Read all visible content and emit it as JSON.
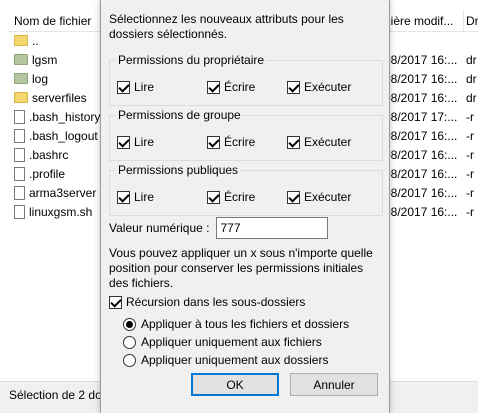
{
  "file_list": {
    "headers": {
      "name": "Nom de fichier",
      "date": "nière modif...",
      "perm": "Dr"
    },
    "rows": [
      {
        "name": "..",
        "icon": "folder-icon",
        "date": "",
        "perm": ""
      },
      {
        "name": "lgsm",
        "icon": "folder-green-icon",
        "date": "08/2017 16:...",
        "perm": "dr"
      },
      {
        "name": "log",
        "icon": "folder-green-icon",
        "date": "08/2017 16:...",
        "perm": "dr"
      },
      {
        "name": "serverfiles",
        "icon": "folder-icon",
        "date": "08/2017 16:...",
        "perm": "dr"
      },
      {
        "name": ".bash_history",
        "icon": "file-icon",
        "date": "08/2017 17:...",
        "perm": "-r"
      },
      {
        "name": ".bash_logout",
        "icon": "file-icon",
        "date": "08/2017 16:...",
        "perm": "-r"
      },
      {
        "name": ".bashrc",
        "icon": "file-icon",
        "date": "08/2017 16:...",
        "perm": "-r"
      },
      {
        "name": ".profile",
        "icon": "file-icon",
        "date": "08/2017 16:...",
        "perm": "-r"
      },
      {
        "name": "arma3server",
        "icon": "file-icon",
        "date": "08/2017 16:...",
        "perm": "-r"
      },
      {
        "name": "linuxgsm.sh",
        "icon": "file-icon",
        "date": "08/2017 16:...",
        "perm": "-r"
      }
    ],
    "status": "Sélection de 2 dos"
  },
  "dialog": {
    "intro": "Sélectionnez les nouveaux attributs pour les dossiers sélectionnés.",
    "groups": [
      {
        "title": "Permissions du propriétaire",
        "read": "Lire",
        "write": "Écrire",
        "execute": "Exécuter",
        "read_checked": true,
        "write_checked": true,
        "execute_checked": true
      },
      {
        "title": "Permissions de groupe",
        "read": "Lire",
        "write": "Écrire",
        "execute": "Exécuter",
        "read_checked": true,
        "write_checked": true,
        "execute_checked": true
      },
      {
        "title": "Permissions publiques",
        "read": "Lire",
        "write": "Écrire",
        "execute": "Exécuter",
        "read_checked": true,
        "write_checked": true,
        "execute_checked": true
      }
    ],
    "numeric_label": "Valeur numérique :",
    "numeric_value": "777",
    "hint": "Vous pouvez appliquer un x sous n'importe quelle position pour conserver les permissions initiales des fichiers.",
    "recurse_label": "Récursion dans les sous-dossiers",
    "recurse_checked": true,
    "radio_options": [
      "Appliquer à tous les fichiers et dossiers",
      "Appliquer uniquement aux fichiers",
      "Appliquer uniquement aux dossiers"
    ],
    "radio_selected_index": 0,
    "ok_label": "OK",
    "cancel_label": "Annuler"
  }
}
